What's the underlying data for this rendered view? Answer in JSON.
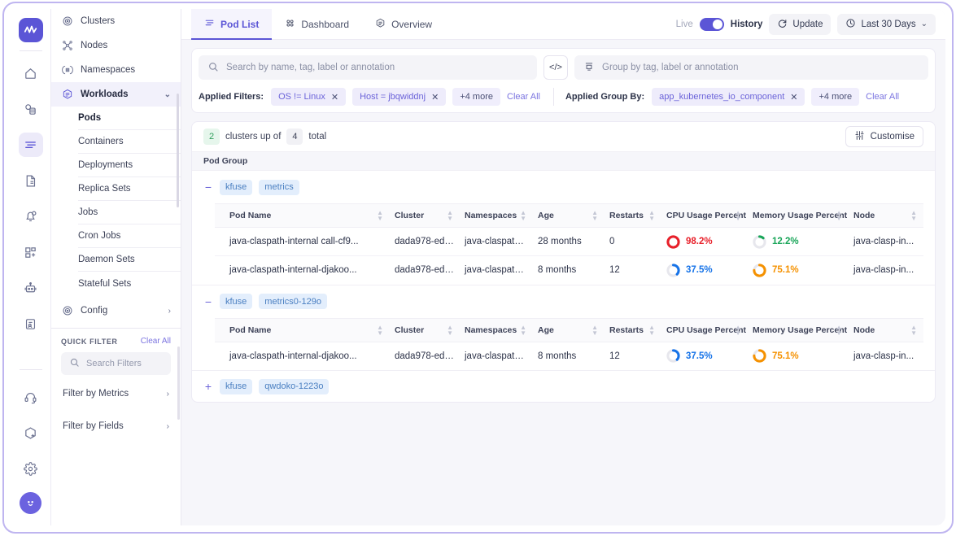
{
  "rail": {
    "logo": "logo-mark",
    "icons": [
      {
        "name": "home-icon"
      },
      {
        "name": "services-icon"
      },
      {
        "name": "logs-icon",
        "active": true
      },
      {
        "name": "document-icon"
      },
      {
        "name": "alerts-icon"
      },
      {
        "name": "add-dashboard-icon"
      },
      {
        "name": "bot-icon"
      },
      {
        "name": "report-icon"
      }
    ],
    "bottom_icons": [
      {
        "name": "support-icon"
      },
      {
        "name": "add-integration-icon"
      },
      {
        "name": "settings-icon"
      }
    ],
    "avatar": "user-avatar"
  },
  "sidebar": {
    "nav": [
      {
        "label": "Clusters",
        "icon": "clusters-icon"
      },
      {
        "label": "Nodes",
        "icon": "nodes-icon"
      },
      {
        "label": "Namespaces",
        "icon": "namespaces-icon"
      },
      {
        "label": "Workloads",
        "icon": "workloads-icon",
        "active": true,
        "chevron": "chevron-down"
      }
    ],
    "workload_items": [
      {
        "label": "Pods",
        "active": true
      },
      {
        "label": "Containers"
      },
      {
        "label": "Deployments"
      },
      {
        "label": "Replica Sets"
      },
      {
        "label": "Jobs"
      },
      {
        "label": "Cron Jobs"
      },
      {
        "label": "Daemon Sets"
      },
      {
        "label": "Stateful Sets"
      }
    ],
    "config": {
      "label": "Config",
      "icon": "config-icon",
      "chevron": "chevron-right"
    },
    "quick_filter": {
      "title": "QUICK FILTER",
      "clear_all": "Clear All",
      "search_placeholder": "Search Filters",
      "rows": [
        {
          "label": "Filter by Metrics"
        },
        {
          "label": "Filter by Fields"
        }
      ]
    }
  },
  "topbar": {
    "tabs": [
      {
        "label": "Pod List",
        "icon": "list-icon",
        "active": true
      },
      {
        "label": "Dashboard",
        "icon": "dashboard-icon"
      },
      {
        "label": "Overview",
        "icon": "overview-icon"
      }
    ],
    "live_label": "Live",
    "history_label": "History",
    "update_label": "Update",
    "time_range": "Last 30 Days"
  },
  "search": {
    "placeholder": "Search by name, tag, label or annotation",
    "code_button": "</>",
    "group_placeholder": "Group by tag, label or annotation"
  },
  "filters": {
    "applied_label": "Applied Filters:",
    "chips": [
      {
        "label": "OS != Linux"
      },
      {
        "label": "Host = jbqwiddnj"
      }
    ],
    "more": "+4 more",
    "clear_all": "Clear All",
    "group_label": "Applied Group By:",
    "group_chips": [
      {
        "label": "app_kubernetes_io_component"
      }
    ],
    "group_more": "+4 more",
    "group_clear_all": "Clear All"
  },
  "list": {
    "up_count": "2",
    "up_text": "clusters up of",
    "total_count": "4",
    "total_text": "total",
    "customise": "Customise",
    "group_bar": "Pod Group",
    "columns": [
      "Pod Name",
      "Cluster",
      "Namespaces",
      "Age",
      "Restarts",
      "CPU Usage Percent",
      "Memory Usage Percent",
      "Node"
    ],
    "groups": [
      {
        "expander": "−",
        "expanded": true,
        "tags": [
          "kfuse",
          "metrics"
        ],
        "rows": [
          {
            "pod": "java-claspath-internal call-cf9...",
            "cluster": "dada978-ed1...",
            "namespace": "java-claspath-in...",
            "age": "28 months",
            "restarts": "0",
            "cpu": {
              "value": "98.2%",
              "pct": 98.2,
              "color": "#e8202a"
            },
            "memory": {
              "value": "12.2%",
              "pct": 12.2,
              "color": "#18a558"
            },
            "node": "java-clasp-in..."
          },
          {
            "pod": "java-claspath-internal-djakoo...",
            "cluster": "dada978-ed1...",
            "namespace": "java-claspath-in...",
            "age": "8 months",
            "restarts": "12",
            "cpu": {
              "value": "37.5%",
              "pct": 37.5,
              "color": "#1673e8"
            },
            "memory": {
              "value": "75.1%",
              "pct": 75.1,
              "color": "#f59100"
            },
            "node": "java-clasp-in..."
          }
        ]
      },
      {
        "expander": "−",
        "expanded": true,
        "tags": [
          "kfuse",
          "metrics0-129o"
        ],
        "rows": [
          {
            "pod": "java-claspath-internal-djakoo...",
            "cluster": "dada978-ed1...",
            "namespace": "java-claspath-in...",
            "age": "8 months",
            "restarts": "12",
            "cpu": {
              "value": "37.5%",
              "pct": 37.5,
              "color": "#1673e8"
            },
            "memory": {
              "value": "75.1%",
              "pct": 75.1,
              "color": "#f59100"
            },
            "node": "java-clasp-in..."
          }
        ]
      },
      {
        "expander": "+",
        "expanded": false,
        "tags": [
          "kfuse",
          "qwdoko-1223o"
        ],
        "rows": []
      }
    ]
  }
}
